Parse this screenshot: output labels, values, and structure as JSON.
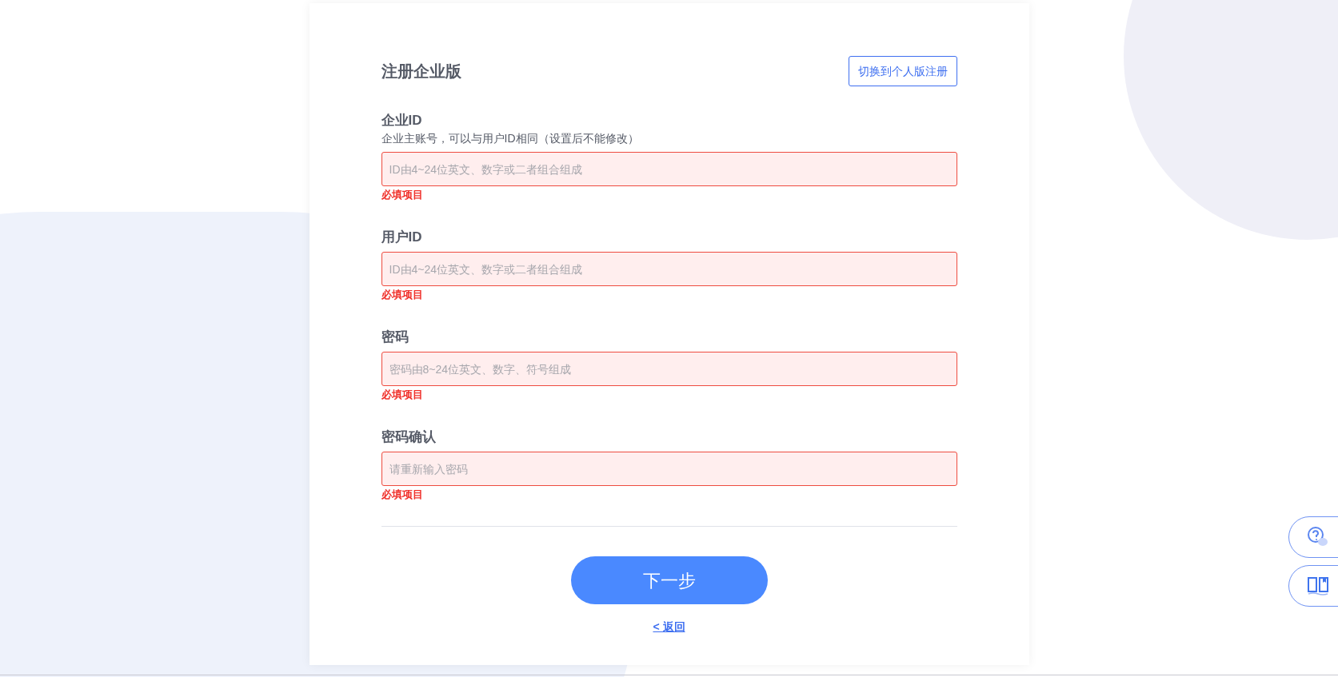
{
  "title": "注册企业版",
  "switch_button": "切换到个人版注册",
  "fields": [
    {
      "label": "企业ID",
      "hint": "企业主账号，可以与用户ID相同（设置后不能修改）",
      "placeholder": "ID由4~24位英文、数字或二者组合组成",
      "error": "必填项目",
      "invalid": true
    },
    {
      "label": "用户ID",
      "placeholder": "ID由4~24位英文、数字或二者组合组成",
      "error": "必填项目",
      "invalid": true
    },
    {
      "label": "密码",
      "placeholder": "密码由8~24位英文、数字、符号组成",
      "error": "必填项目",
      "invalid": true
    },
    {
      "label": "密码确认",
      "placeholder": "请重新输入密码",
      "error": "必填项目",
      "invalid": true
    }
  ],
  "next_button": "下一步",
  "back_link": "< 返回",
  "side_buttons": [
    {
      "kind": "help"
    },
    {
      "kind": "manual"
    }
  ]
}
